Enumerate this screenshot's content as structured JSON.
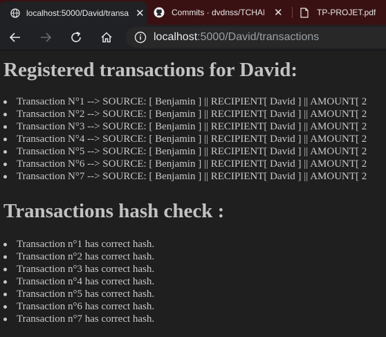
{
  "browser": {
    "tabs": [
      {
        "title": "localhost:5000/David/transa",
        "icon": "globe-icon",
        "active": true
      },
      {
        "title": "Commits · dvdnss/TCHAI-D",
        "icon": "github-icon",
        "active": false
      },
      {
        "title": "TP-PROJET.pdf",
        "icon": "document-icon",
        "active": false
      }
    ],
    "close_glyph": "✕",
    "address": {
      "host": "localhost",
      "rest": ":5000/David/transactions"
    }
  },
  "page": {
    "heading": "Registered transactions for David:",
    "transactions": [
      {
        "text": "Transaction N°1 --> SOURCE: [ Benjamin ] || RECIPIENT[ David ] || AMOUNT[ 2"
      },
      {
        "text": "Transaction N°2 --> SOURCE: [ Benjamin ] || RECIPIENT[ David ] || AMOUNT[ 2"
      },
      {
        "text": "Transaction N°3 --> SOURCE: [ Benjamin ] || RECIPIENT[ David ] || AMOUNT[ 2"
      },
      {
        "text": "Transaction N°4 --> SOURCE: [ Benjamin ] || RECIPIENT[ David ] || AMOUNT[ 2"
      },
      {
        "text": "Transaction N°5 --> SOURCE: [ Benjamin ] || RECIPIENT[ David ] || AMOUNT[ 2"
      },
      {
        "text": "Transaction N°6 --> SOURCE: [ Benjamin ] || RECIPIENT[ David ] || AMOUNT[ 2"
      },
      {
        "text": "Transaction N°7 --> SOURCE: [ Benjamin ] || RECIPIENT[ David ] || AMOUNT[ 2"
      }
    ],
    "hash_heading": "Transactions hash check :",
    "hash_checks": [
      {
        "text": "Transaction n°1 has correct hash."
      },
      {
        "text": "Transaction n°2 has correct hash."
      },
      {
        "text": "Transaction n°3 has correct hash."
      },
      {
        "text": "Transaction n°4 has correct hash."
      },
      {
        "text": "Transaction n°5 has correct hash."
      },
      {
        "text": "Transaction n°6 has correct hash."
      },
      {
        "text": "Transaction n°7 has correct hash."
      }
    ]
  },
  "colors": {
    "tab_strip": "#3a1112",
    "page_background": "#1f1f1f",
    "text": "#c8c8c8"
  }
}
